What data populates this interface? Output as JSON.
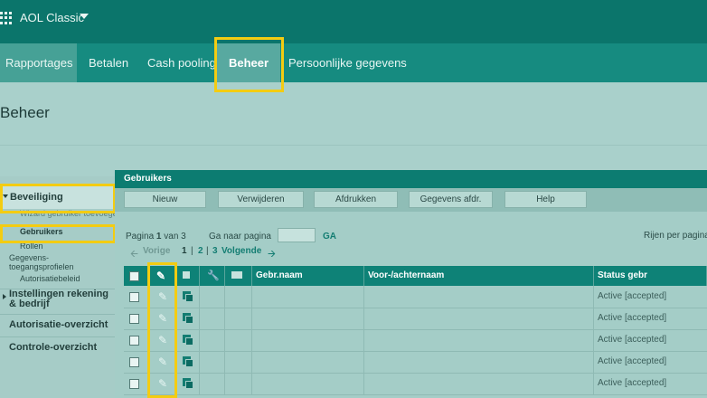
{
  "app": {
    "title": "AOL Classic"
  },
  "nav": {
    "items": [
      {
        "label": "Rapportages"
      },
      {
        "label": "Betalen"
      },
      {
        "label": "Cash pooling"
      },
      {
        "label": "Beheer"
      },
      {
        "label": "Persoonlijke gegevens"
      }
    ]
  },
  "page": {
    "title": "Beheer"
  },
  "sidebar": {
    "sections": [
      {
        "label": "Beveiliging"
      },
      {
        "label": "Instellingen rekening & bedrijf"
      },
      {
        "label": "Autorisatie-overzicht"
      },
      {
        "label": "Controle-overzicht"
      }
    ],
    "sub_items": [
      {
        "label": "Wizard gebruiker toevoegen"
      },
      {
        "label": "Gebruikers"
      },
      {
        "label": "Rollen"
      },
      {
        "label": "Gegevens-"
      },
      {
        "label": "toegangsprofielen"
      },
      {
        "label": "Autorisatiebeleid"
      }
    ]
  },
  "panel": {
    "title": "Gebruikers",
    "buttons": [
      {
        "label": "Nieuw"
      },
      {
        "label": "Verwijderen"
      },
      {
        "label": "Afdrukken"
      },
      {
        "label": "Gegevens afdr."
      },
      {
        "label": "Help"
      }
    ],
    "pagination": {
      "pagina_label": "Pagina",
      "current": "1",
      "van_label": "van 3",
      "goto_label": "Ga naar pagina",
      "go_label": "GA",
      "rows_per_page_label": "Rijen per pagina",
      "prev_label": "Vorige",
      "page_1": "1",
      "page_2": "2",
      "page_3": "3",
      "next_label": "Volgende",
      "separator": "|"
    }
  },
  "table": {
    "columns": [
      "Gebr.naam",
      "Voor-/achternaam",
      "Status gebr"
    ],
    "rows": [
      {
        "status": "Active [accepted]"
      },
      {
        "status": "Active [accepted]"
      },
      {
        "status": "Active [accepted]"
      },
      {
        "status": "Active [accepted]"
      },
      {
        "status": "Active [accepted]"
      }
    ]
  },
  "colors": {
    "highlight": "#f3cc12",
    "primary": "#0b756b",
    "nav": "#168b80",
    "background": "#a9d0cb"
  }
}
